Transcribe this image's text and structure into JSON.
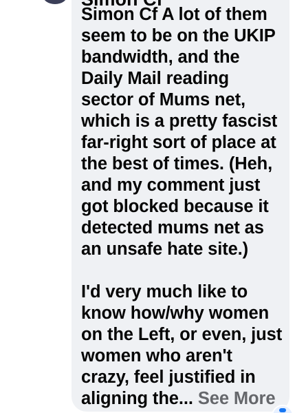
{
  "comment": {
    "author_partial": "Simon Cf",
    "paragraph_1": "Simon Cf A lot of them\nseem to be on the UKIP\nbandwidth, and the\nDaily Mail reading\nsector of Mums net,\nwhich is a pretty fascist\nfar-right sort of place at\nthe best of times. (Heh,\nand my comment just\ngot blocked because it\ndetected mums net as\nan unsafe hate site.)",
    "paragraph_2": "I'd very much like to\nknow how/why women\non the Left, or even, just\nwomen who aren't\ncrazy, feel justified in\naligning the... ",
    "see_more_label": "See More"
  },
  "colors": {
    "bubble_background": "#eff1f4",
    "text": "#050505",
    "see_more": "#65676b",
    "accent": "#1877f2"
  }
}
